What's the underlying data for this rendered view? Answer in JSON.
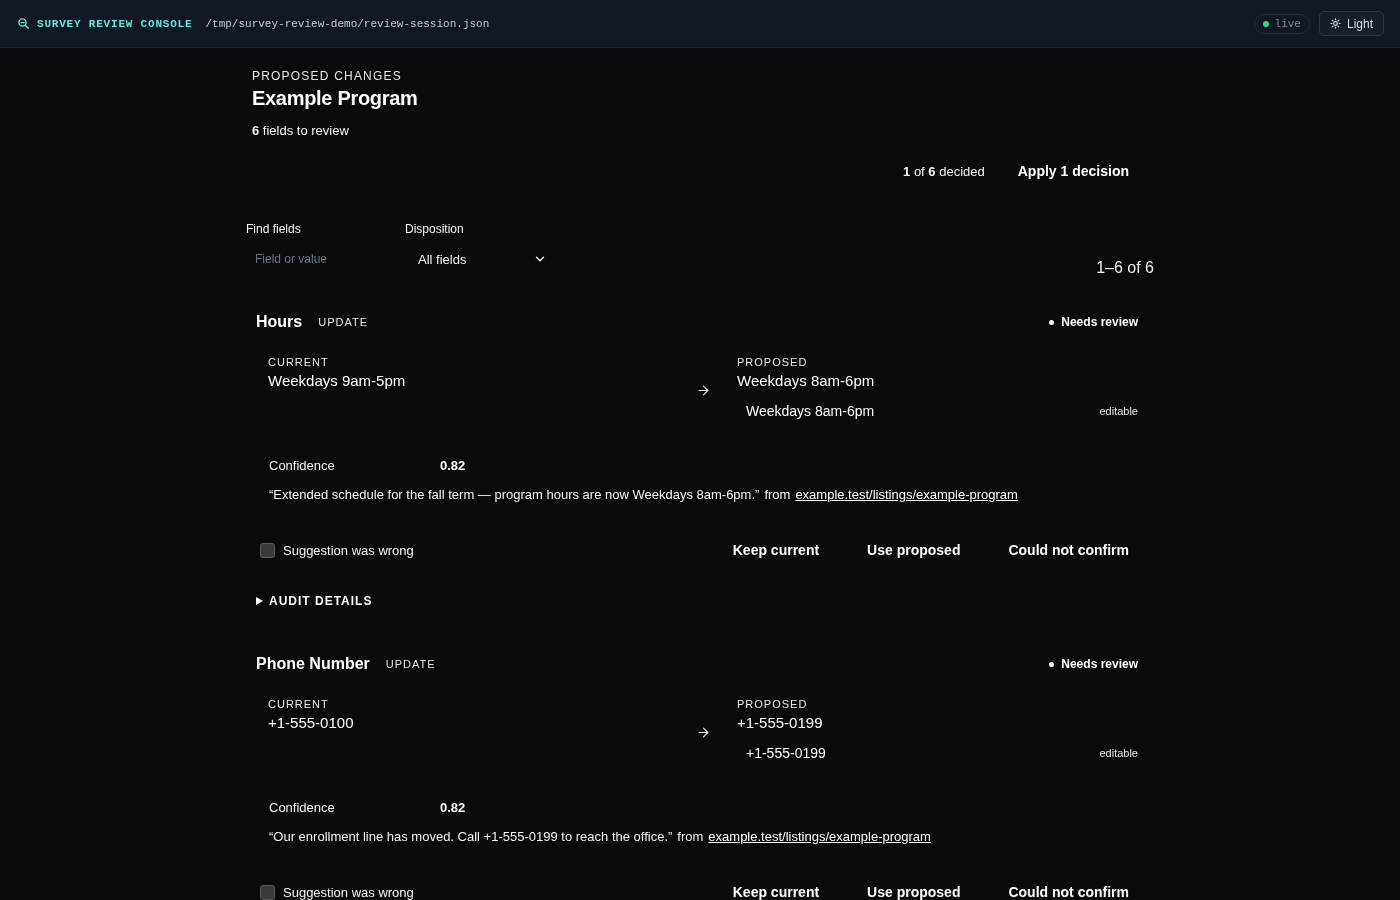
{
  "header": {
    "title": "SURVEY REVIEW CONSOLE",
    "path": "/tmp/survey-review-demo/review-session.json",
    "status": "live",
    "theme_button": "Light"
  },
  "summary": {
    "eyebrow": "PROPOSED CHANGES",
    "title": "Example Program",
    "count": "**6** fields to review",
    "progress": "**1** of **6** decided",
    "apply_button": "Apply 1 decision"
  },
  "filters": {
    "search": {
      "label": "Find fields",
      "placeholder": "Field or value"
    },
    "disposition": {
      "label": "Disposition",
      "value": "All fields"
    },
    "range": "1–6 of 6"
  },
  "fields": [
    {
      "name": "Hours",
      "change_type": "UPDATE",
      "status": "Needs review",
      "current": {
        "label": "CURRENT",
        "value": "Weekdays 9am-5pm"
      },
      "proposed": {
        "label": "PROPOSED",
        "value": "Weekdays 8am-6pm",
        "edit_value": "Weekdays 8am-6pm",
        "edit_note": "editable"
      },
      "confidence": {
        "label": "Confidence",
        "value": "0.82"
      },
      "evidence": {
        "quote": "“Extended schedule for the fall term — program hours are now Weekdays 8am-6pm.”",
        "prefix": "from",
        "link": "example.test/listings/example-program"
      },
      "wrong": {
        "label": "Suggestion was wrong",
        "checked": false
      },
      "actions": [
        {
          "label": "Keep current",
          "selected": false
        },
        {
          "label": "Use proposed",
          "selected": false
        },
        {
          "label": "Could not confirm",
          "selected": false
        }
      ],
      "audit": {
        "label": "AUDIT DETAILS",
        "expanded": false
      }
    },
    {
      "name": "Phone Number",
      "change_type": "UPDATE",
      "status": "Needs review",
      "current": {
        "label": "CURRENT",
        "value": "+1-555-0100"
      },
      "proposed": {
        "label": "PROPOSED",
        "value": "+1-555-0199",
        "edit_value": "+1-555-0199",
        "edit_note": "editable"
      },
      "confidence": {
        "label": "Confidence",
        "value": "0.82"
      },
      "evidence": {
        "quote": "“Our enrollment line has moved. Call +1-555-0199 to reach the office.”",
        "prefix": "from",
        "link": "example.test/listings/example-program"
      },
      "wrong": {
        "label": "Suggestion was wrong",
        "checked": false
      },
      "actions": [
        {
          "label": "Keep current",
          "selected": false
        },
        {
          "label": "Use proposed",
          "selected": false
        },
        {
          "label": "Could not confirm",
          "selected": false
        }
      ]
    }
  ]
}
